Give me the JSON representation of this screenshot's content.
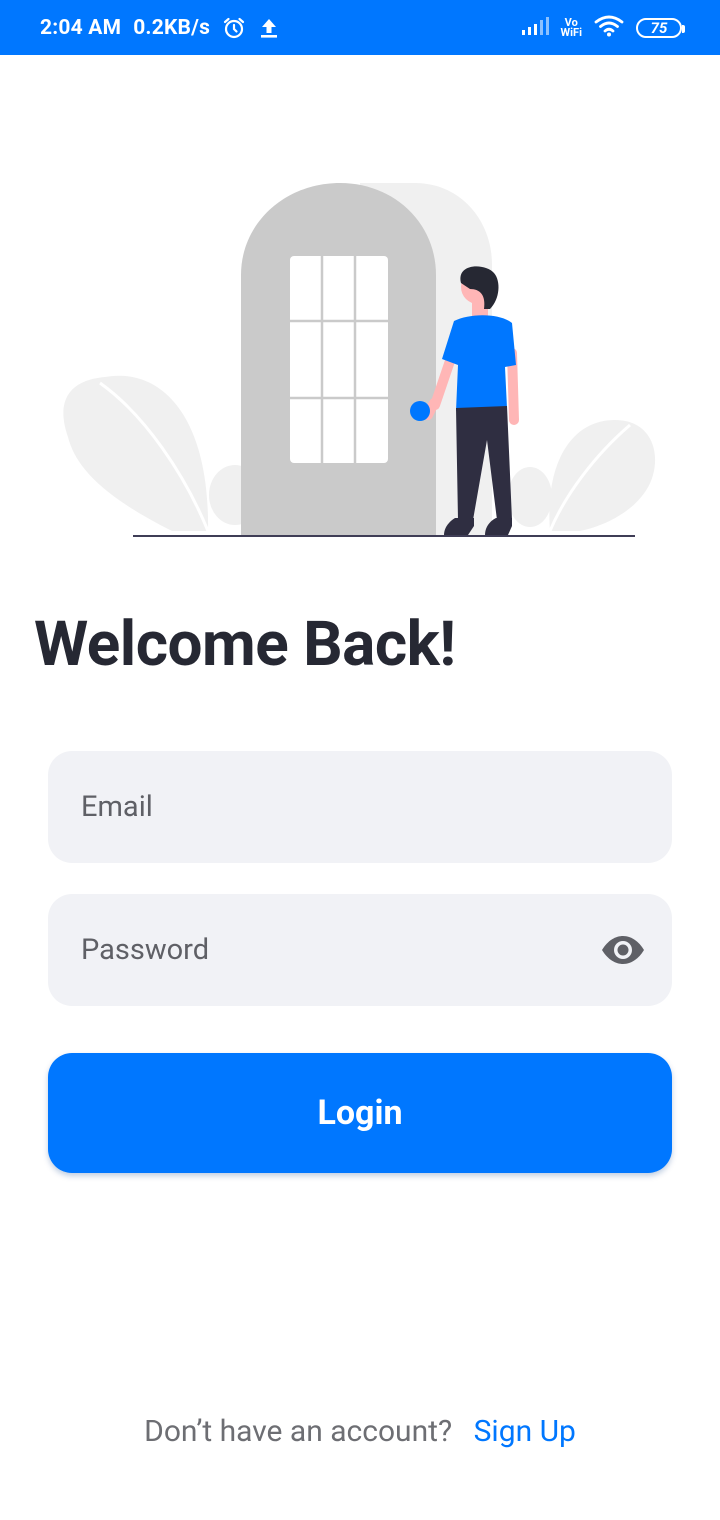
{
  "status_bar": {
    "time": "2:04 AM",
    "speed": "0.2KB/s",
    "vowifi_top": "Vo",
    "vowifi_bottom": "WiFi",
    "battery": "75"
  },
  "illustration": {
    "name": "person-at-door-illustration"
  },
  "title": "Welcome Back!",
  "form": {
    "email_placeholder": "Email",
    "email_value": "",
    "password_placeholder": "Password",
    "password_value": "",
    "login_label": "Login"
  },
  "footer": {
    "prompt": "Don’t have an account?",
    "signup_label": "Sign Up"
  },
  "colors": {
    "primary": "#0077ff",
    "field_bg": "#f1f2f6",
    "title_text": "#262833",
    "muted_text": "#6d6e73"
  }
}
